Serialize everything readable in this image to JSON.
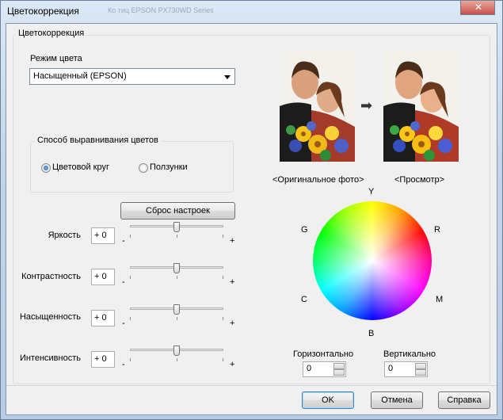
{
  "window": {
    "title": "Цветокоррекция",
    "ghost_title": "Ко тиц EPSON PX730WD Series"
  },
  "group": {
    "title": "Цветокоррекция"
  },
  "color_mode": {
    "label": "Режим цвета",
    "selected": "Насыщенный (EPSON)"
  },
  "method": {
    "title": "Способ выравнивания цветов",
    "options": [
      {
        "label": "Цветовой круг",
        "selected": true
      },
      {
        "label": "Ползунки",
        "selected": false
      }
    ]
  },
  "reset_label": "Сброс настроек",
  "sliders": [
    {
      "label": "Яркость",
      "value": "+ 0",
      "minus": "-",
      "plus": "+",
      "level": 0.5
    },
    {
      "label": "Контрастность",
      "value": "+ 0",
      "minus": "-",
      "plus": "+",
      "level": 0.5
    },
    {
      "label": "Насыщенность",
      "value": "+ 0",
      "minus": "-",
      "plus": "+",
      "level": 0.5
    },
    {
      "label": "Интенсивность",
      "value": "+ 0",
      "minus": "-",
      "plus": "+",
      "level": 0.5
    }
  ],
  "preview": {
    "original_label": "<Оригинальное фото>",
    "preview_label": "<Просмотр>"
  },
  "wheel": {
    "labels": {
      "y": "Y",
      "r": "R",
      "m": "M",
      "b": "B",
      "c": "C",
      "g": "G"
    },
    "center_mark": "+"
  },
  "offsets": {
    "horizontal_label": "Горизонтально",
    "horizontal_value": "0",
    "vertical_label": "Вертикально",
    "vertical_value": "0"
  },
  "buttons": {
    "ok": "OK",
    "cancel": "Отмена",
    "help": "Справка"
  }
}
